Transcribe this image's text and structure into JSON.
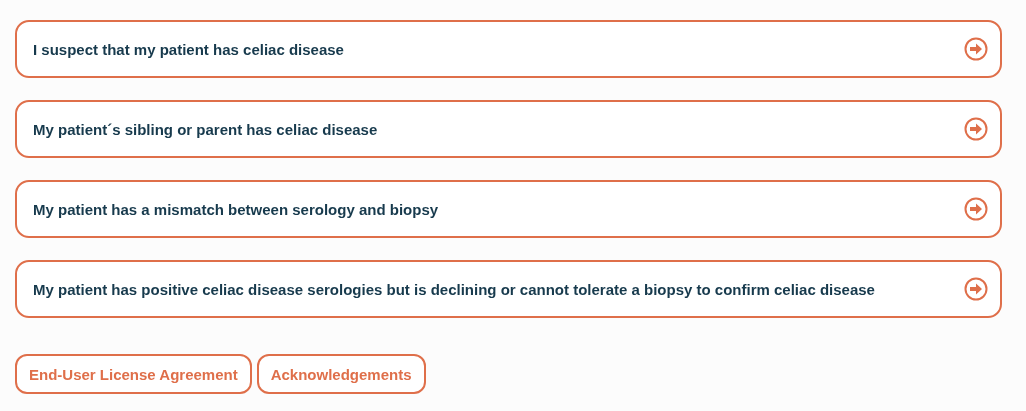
{
  "options": [
    {
      "label": "I suspect that my patient has celiac disease"
    },
    {
      "label": "My patient´s sibling or parent has celiac disease"
    },
    {
      "label": "My patient has a mismatch between serology and biopsy"
    },
    {
      "label": "My patient has positive celiac disease serologies but is declining or cannot tolerate a biopsy to confirm celiac disease"
    }
  ],
  "footer_links": [
    "End-User License Agreement",
    "Acknowledgements"
  ]
}
